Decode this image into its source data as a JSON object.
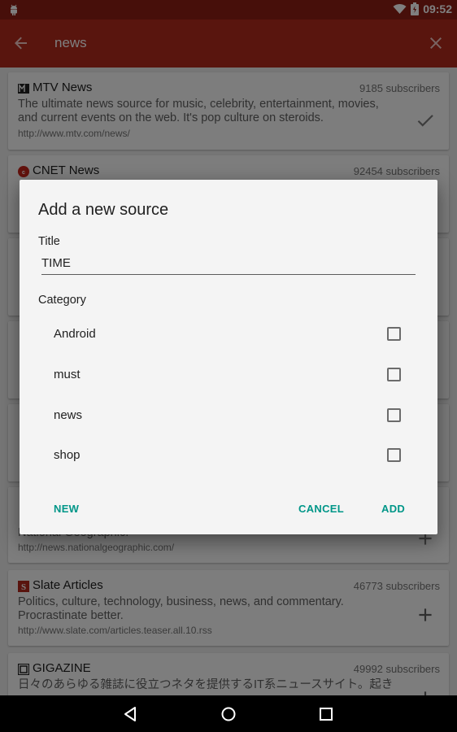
{
  "status_bar": {
    "time": "09:52"
  },
  "toolbar": {
    "query": "news"
  },
  "sources": [
    {
      "title": "MTV News",
      "subscribers": "9185 subscribers",
      "description": "The ultimate news source for music, celebrity, entertainment, movies, and current events on the web. It's pop culture on steroids.",
      "url": "http://www.mtv.com/news/",
      "action": "check-icon"
    },
    {
      "title": "CNET News",
      "subscribers": "92454 subscribers",
      "description": "",
      "url": "",
      "action": "add-icon"
    },
    {
      "title": "",
      "subscribers": "",
      "description": "National Geographic.",
      "url": "http://news.nationalgeographic.com/",
      "action": "add-icon"
    },
    {
      "title": "Slate Articles",
      "subscribers": "46773 subscribers",
      "description": "Politics, culture, technology, business, news, and commentary. Procrastinate better.",
      "url": "http://www.slate.com/articles.teaser.all.10.rss",
      "action": "add-icon"
    },
    {
      "title": "GIGAZINE",
      "subscribers": "49992 subscribers",
      "description": "日々のあらゆる雑誌に役立つネタを提供するIT系ニュースサイト。起き",
      "url": "",
      "action": "add-icon"
    }
  ],
  "dialog": {
    "title": "Add a new source",
    "title_field_label": "Title",
    "title_field_value": "TIME",
    "category_label": "Category",
    "categories": [
      {
        "name": "Android",
        "checked": false
      },
      {
        "name": "must",
        "checked": false
      },
      {
        "name": "news",
        "checked": false
      },
      {
        "name": "shop",
        "checked": false
      }
    ],
    "buttons": {
      "new": "NEW",
      "cancel": "CANCEL",
      "add": "ADD"
    }
  },
  "colors": {
    "primary": "#b22a1d",
    "primary_dark": "#8e1f15",
    "accent": "#009688"
  }
}
